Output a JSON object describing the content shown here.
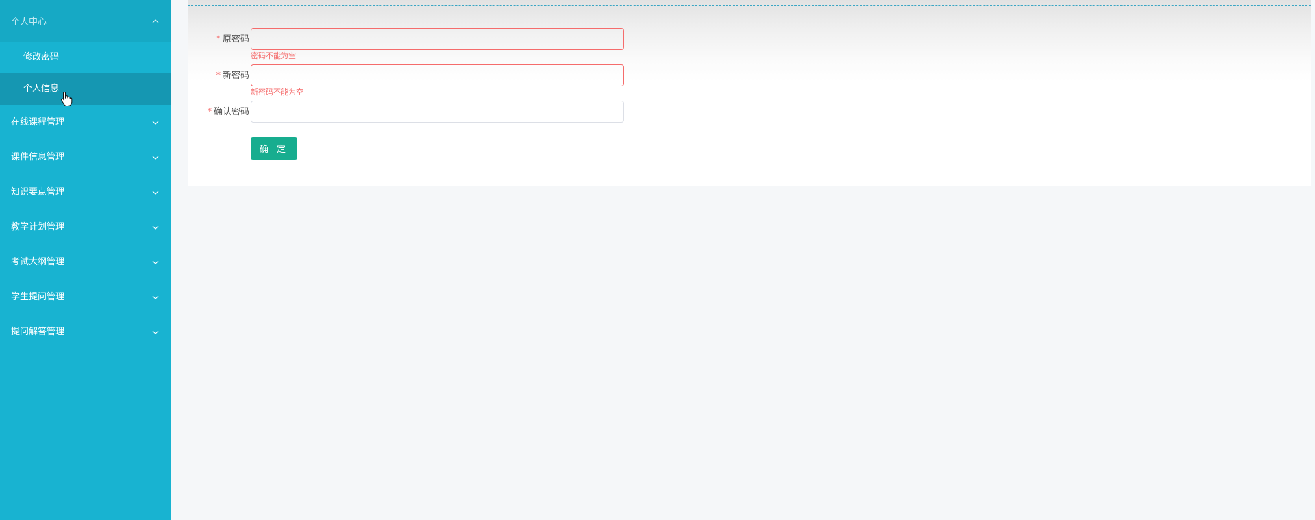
{
  "sidebar": {
    "groups": [
      {
        "label": "个人中心",
        "expanded": true,
        "items": [
          {
            "label": "修改密码",
            "active": false
          },
          {
            "label": "个人信息",
            "active": true
          }
        ]
      },
      {
        "label": "在线课程管理",
        "expanded": false
      },
      {
        "label": "课件信息管理",
        "expanded": false
      },
      {
        "label": "知识要点管理",
        "expanded": false
      },
      {
        "label": "教学计划管理",
        "expanded": false
      },
      {
        "label": "考试大纲管理",
        "expanded": false
      },
      {
        "label": "学生提问管理",
        "expanded": false
      },
      {
        "label": "提问解答管理",
        "expanded": false
      }
    ],
    "chevron_up_icon": "chevron-up-icon",
    "chevron_down_icon": "chevron-down-icon"
  },
  "form": {
    "required_mark": "*",
    "old_password": {
      "label": "原密码",
      "value": "",
      "error": "密码不能为空"
    },
    "new_password": {
      "label": "新密码",
      "value": "",
      "error": "新密码不能为空"
    },
    "confirm_password": {
      "label": "确认密码",
      "value": ""
    },
    "submit_label": "确 定"
  },
  "colors": {
    "sidebar_bg": "#18b3d1",
    "sidebar_active": "#1597b2",
    "error": "#f56c6c",
    "primary_button": "#17ad8f"
  }
}
